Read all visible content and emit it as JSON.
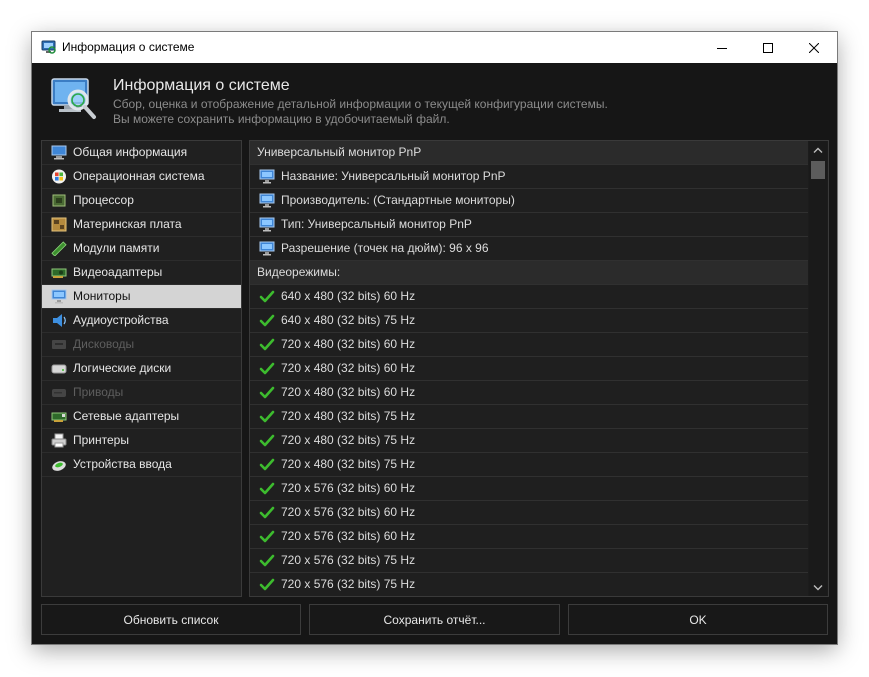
{
  "window": {
    "title": "Информация о системе",
    "controls": {
      "minimize": "minimize",
      "maximize": "maximize",
      "close": "close"
    }
  },
  "header": {
    "title": "Информация о системе",
    "description_line1": "Сбор, оценка и отображение детальной информации о текущей конфигурации системы.",
    "description_line2": "Вы можете сохранить информацию в удобочитаемый файл."
  },
  "sidebar": {
    "items": [
      {
        "label": "Общая информация",
        "icon": "computer-icon",
        "state": "normal"
      },
      {
        "label": "Операционная система",
        "icon": "windows-logo-icon",
        "state": "normal"
      },
      {
        "label": "Процессор",
        "icon": "cpu-icon",
        "state": "normal"
      },
      {
        "label": "Материнская плата",
        "icon": "motherboard-icon",
        "state": "normal"
      },
      {
        "label": "Модули памяти",
        "icon": "memory-stick-icon",
        "state": "normal"
      },
      {
        "label": "Видеоадаптеры",
        "icon": "video-card-icon",
        "state": "normal"
      },
      {
        "label": "Мониторы",
        "icon": "monitor-icon",
        "state": "selected"
      },
      {
        "label": "Аудиоустройства",
        "icon": "speaker-icon",
        "state": "normal"
      },
      {
        "label": "Дисководы",
        "icon": "floppy-drive-icon",
        "state": "disabled"
      },
      {
        "label": "Логические диски",
        "icon": "hard-disk-icon",
        "state": "normal"
      },
      {
        "label": "Приводы",
        "icon": "optical-drive-icon",
        "state": "disabled"
      },
      {
        "label": "Сетевые адаптеры",
        "icon": "network-card-icon",
        "state": "normal"
      },
      {
        "label": "Принтеры",
        "icon": "printer-icon",
        "state": "normal"
      },
      {
        "label": "Устройства ввода",
        "icon": "mouse-icon",
        "state": "normal"
      }
    ]
  },
  "content": {
    "rows": [
      {
        "type": "header",
        "text": "Универсальный монитор PnP"
      },
      {
        "type": "property",
        "icon": "monitor-icon",
        "text": "Название: Универсальный монитор PnP"
      },
      {
        "type": "property",
        "icon": "monitor-icon",
        "text": "Производитель: (Стандартные мониторы)"
      },
      {
        "type": "property",
        "icon": "monitor-icon",
        "text": "Тип: Универсальный монитор PnP"
      },
      {
        "type": "property",
        "icon": "monitor-icon",
        "text": "Разрешение (точек на дюйм): 96 x 96"
      },
      {
        "type": "header",
        "text": "Видеорежимы:"
      },
      {
        "type": "mode",
        "icon": "checkmark-icon",
        "text": "640 x 480 (32 bits) 60 Hz"
      },
      {
        "type": "mode",
        "icon": "checkmark-icon",
        "text": "640 x 480 (32 bits) 75 Hz"
      },
      {
        "type": "mode",
        "icon": "checkmark-icon",
        "text": "720 x 480 (32 bits) 60 Hz"
      },
      {
        "type": "mode",
        "icon": "checkmark-icon",
        "text": "720 x 480 (32 bits) 60 Hz"
      },
      {
        "type": "mode",
        "icon": "checkmark-icon",
        "text": "720 x 480 (32 bits) 60 Hz"
      },
      {
        "type": "mode",
        "icon": "checkmark-icon",
        "text": "720 x 480 (32 bits) 75 Hz"
      },
      {
        "type": "mode",
        "icon": "checkmark-icon",
        "text": "720 x 480 (32 bits) 75 Hz"
      },
      {
        "type": "mode",
        "icon": "checkmark-icon",
        "text": "720 x 480 (32 bits) 75 Hz"
      },
      {
        "type": "mode",
        "icon": "checkmark-icon",
        "text": "720 x 576 (32 bits) 60 Hz"
      },
      {
        "type": "mode",
        "icon": "checkmark-icon",
        "text": "720 x 576 (32 bits) 60 Hz"
      },
      {
        "type": "mode",
        "icon": "checkmark-icon",
        "text": "720 x 576 (32 bits) 60 Hz"
      },
      {
        "type": "mode",
        "icon": "checkmark-icon",
        "text": "720 x 576 (32 bits) 75 Hz"
      },
      {
        "type": "mode",
        "icon": "checkmark-icon",
        "text": "720 x 576 (32 bits) 75 Hz"
      }
    ]
  },
  "footer": {
    "refresh_label": "Обновить список",
    "save_label": "Сохранить отчёт...",
    "ok_label": "OK"
  },
  "colors": {
    "window_bg": "#161616",
    "selected_bg": "#d4d4d4",
    "check_green": "#3dbb2e",
    "disabled_text": "#5e5e5e"
  }
}
